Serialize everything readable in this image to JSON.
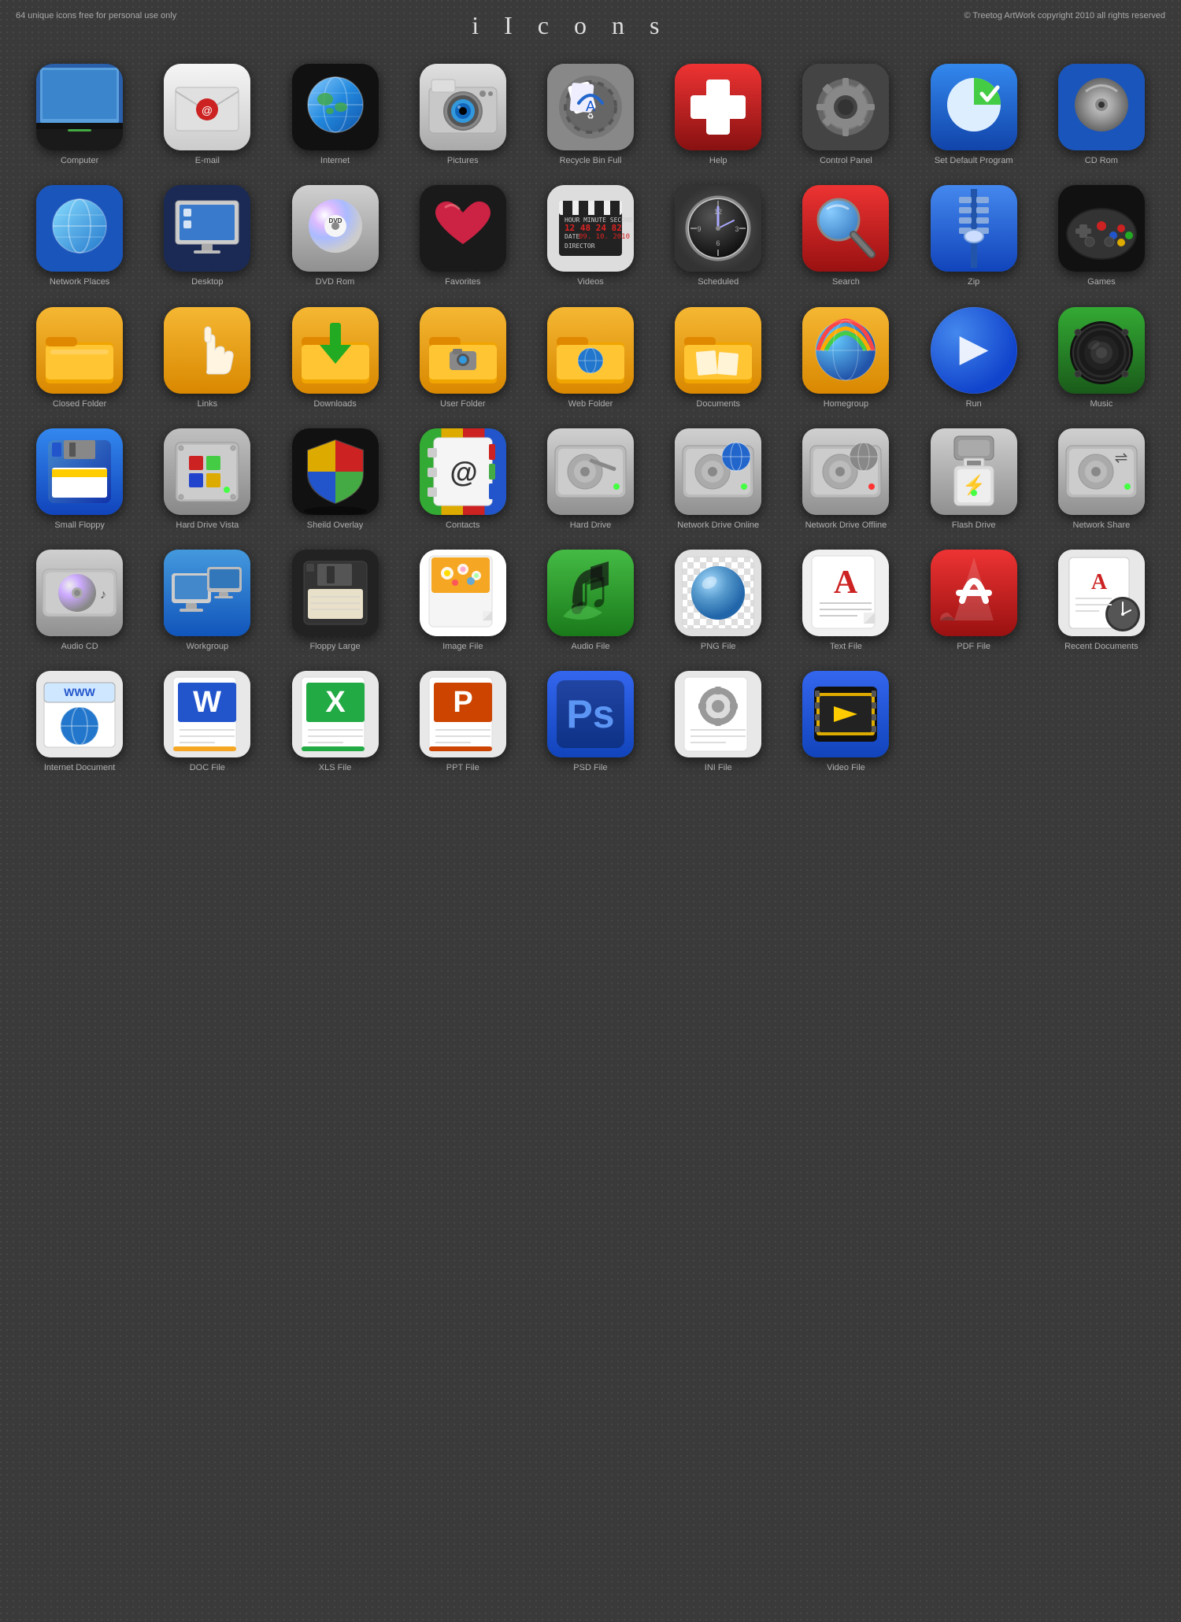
{
  "header": {
    "left_text": "64 unique icons free for personal use only",
    "title": "i  I c o n s",
    "right_text": "© Treetog ArtWork copyright 2010 all rights reserved"
  },
  "icons": [
    {
      "id": "computer",
      "label": "Computer",
      "bg": "#1a3a7a",
      "emoji": "🖥",
      "style": "dark-base"
    },
    {
      "id": "email",
      "label": "E-mail",
      "bg": "#e8e8e8",
      "emoji": "✉",
      "style": "white"
    },
    {
      "id": "internet",
      "label": "Internet",
      "bg": "#111",
      "emoji": "🌐",
      "style": "dark"
    },
    {
      "id": "pictures",
      "label": "Pictures",
      "bg": "#bbb",
      "emoji": "📷",
      "style": "silver"
    },
    {
      "id": "recycle-bin-full",
      "label": "Recycle Bin Full",
      "bg": "#888",
      "emoji": "♻",
      "style": "silver"
    },
    {
      "id": "help",
      "label": "Help",
      "bg": "#cc2222",
      "emoji": "➕",
      "style": "red"
    },
    {
      "id": "control-panel",
      "label": "Control Panel",
      "bg": "#555",
      "emoji": "⚙",
      "style": "dark"
    },
    {
      "id": "set-default-program",
      "label": "Set Default Program",
      "bg": "#1155cc",
      "emoji": "✔",
      "style": "blue"
    },
    {
      "id": "cd-rom",
      "label": "CD Rom",
      "bg": "#1155cc",
      "emoji": "💿",
      "style": "blue"
    },
    {
      "id": "network-places",
      "label": "Network Places",
      "bg": "#1155cc",
      "emoji": "🌐",
      "style": "blue"
    },
    {
      "id": "desktop",
      "label": "Desktop",
      "bg": "#223366",
      "emoji": "🖥",
      "style": "dark-blue"
    },
    {
      "id": "dvd-rom",
      "label": "DVD Rom",
      "bg": "#ccc",
      "emoji": "📀",
      "style": "silver"
    },
    {
      "id": "favorites",
      "label": "Favorites",
      "bg": "#222",
      "emoji": "❤",
      "style": "dark"
    },
    {
      "id": "videos",
      "label": "Videos",
      "bg": "#eee",
      "emoji": "🎬",
      "style": "white"
    },
    {
      "id": "scheduled",
      "label": "Scheduled",
      "bg": "#555",
      "emoji": "🕐",
      "style": "dark-clock"
    },
    {
      "id": "search",
      "label": "Search",
      "bg": "#cc2222",
      "emoji": "🔍",
      "style": "red"
    },
    {
      "id": "zip",
      "label": "Zip",
      "bg": "#1a66cc",
      "emoji": "🤐",
      "style": "blue"
    },
    {
      "id": "games",
      "label": "Games",
      "bg": "#111",
      "emoji": "🎮",
      "style": "dark"
    },
    {
      "id": "closed-folder",
      "label": "Closed Folder",
      "bg": "#f5a623",
      "emoji": "📁",
      "style": "orange"
    },
    {
      "id": "links",
      "label": "Links",
      "bg": "#f5a623",
      "emoji": "☞",
      "style": "orange"
    },
    {
      "id": "downloads",
      "label": "Downloads",
      "bg": "#f5a623",
      "emoji": "📥",
      "style": "orange"
    },
    {
      "id": "user-folder",
      "label": "User Folder",
      "bg": "#f5a623",
      "emoji": "📂",
      "style": "orange"
    },
    {
      "id": "web-folder",
      "label": "Web Folder",
      "bg": "#f5a623",
      "emoji": "🌐",
      "style": "orange"
    },
    {
      "id": "documents",
      "label": "Documents",
      "bg": "#f5a623",
      "emoji": "📄",
      "style": "orange"
    },
    {
      "id": "homegroup",
      "label": "Homegroup",
      "bg": "#f5a623",
      "emoji": "🌍",
      "style": "orange"
    },
    {
      "id": "run",
      "label": "Run",
      "bg": "#1155cc",
      "emoji": "▶",
      "style": "blue-round"
    },
    {
      "id": "music",
      "label": "Music",
      "bg": "#2a8a2a",
      "emoji": "🔊",
      "style": "green"
    },
    {
      "id": "small-floppy",
      "label": "Small Floppy",
      "bg": "#1155cc",
      "emoji": "💾",
      "style": "blue"
    },
    {
      "id": "hard-drive-vista",
      "label": "Hard Drive Vista",
      "bg": "#aaa",
      "emoji": "💽",
      "style": "silver"
    },
    {
      "id": "shield-overlay",
      "label": "Sheild Overlay",
      "bg": "#111",
      "emoji": "🛡",
      "style": "dark"
    },
    {
      "id": "contacts",
      "label": "Contacts",
      "bg": "#2a8a2a",
      "emoji": "@",
      "style": "green"
    },
    {
      "id": "hard-drive",
      "label": "Hard Drive",
      "bg": "#bbb",
      "emoji": "💽",
      "style": "silver-small"
    },
    {
      "id": "network-drive-online",
      "label": "Network Drive Online",
      "bg": "#bbb",
      "emoji": "🌐",
      "style": "silver-small"
    },
    {
      "id": "network-drive-offline",
      "label": "Network Drive Offline",
      "bg": "#bbb",
      "emoji": "🌐",
      "style": "silver-small"
    },
    {
      "id": "flash-drive",
      "label": "Flash Drive",
      "bg": "#bbb",
      "emoji": "⚡",
      "style": "silver-small"
    },
    {
      "id": "network-share",
      "label": "Network Share",
      "bg": "#bbb",
      "emoji": "🔗",
      "style": "silver-small"
    },
    {
      "id": "audio-cd",
      "label": "Audio CD",
      "bg": "#bbb",
      "emoji": "💿",
      "style": "silver-small"
    },
    {
      "id": "workgroup",
      "label": "Workgroup",
      "bg": "#2266cc",
      "emoji": "🖥",
      "style": "blue-small"
    },
    {
      "id": "floppy-large",
      "label": "Floppy Large",
      "bg": "#111",
      "emoji": "💾",
      "style": "dark-small"
    },
    {
      "id": "image-file",
      "label": "Image File",
      "bg": "#f5a623",
      "emoji": "🌸",
      "style": "orange-doc"
    },
    {
      "id": "audio-file",
      "label": "Audio File",
      "bg": "#2a8a2a",
      "emoji": "🎵",
      "style": "green"
    },
    {
      "id": "png-file",
      "label": "PNG File",
      "bg": "#e8e8e8",
      "emoji": "🖼",
      "style": "white"
    },
    {
      "id": "text-file",
      "label": "Text File",
      "bg": "#e8e8e8",
      "emoji": "📝",
      "style": "white"
    },
    {
      "id": "pdf-file",
      "label": "PDF File",
      "bg": "#cc2222",
      "emoji": "📄",
      "style": "red"
    },
    {
      "id": "recent-documents",
      "label": "Recent Documents",
      "bg": "#e8e8e8",
      "emoji": "📋",
      "style": "white-small"
    },
    {
      "id": "internet-document",
      "label": "Internet Document",
      "bg": "#e8e8e8",
      "emoji": "🌐",
      "style": "white-small"
    },
    {
      "id": "doc-file",
      "label": "DOC File",
      "bg": "#e8e8e8",
      "emoji": "📝",
      "style": "white-small"
    },
    {
      "id": "xls-file",
      "label": "XLS File",
      "bg": "#e8e8e8",
      "emoji": "📊",
      "style": "white-small"
    },
    {
      "id": "ppt-file",
      "label": "PPT File",
      "bg": "#e8e8e8",
      "emoji": "📊",
      "style": "white-small"
    },
    {
      "id": "psd-file",
      "label": "PSD File",
      "bg": "#1155cc",
      "emoji": "🎨",
      "style": "blue-small"
    },
    {
      "id": "ini-file",
      "label": "INI File",
      "bg": "#e8e8e8",
      "emoji": "⚙",
      "style": "white-small"
    },
    {
      "id": "video-file",
      "label": "Video File",
      "bg": "#1155cc",
      "emoji": "🎬",
      "style": "blue-small"
    }
  ]
}
